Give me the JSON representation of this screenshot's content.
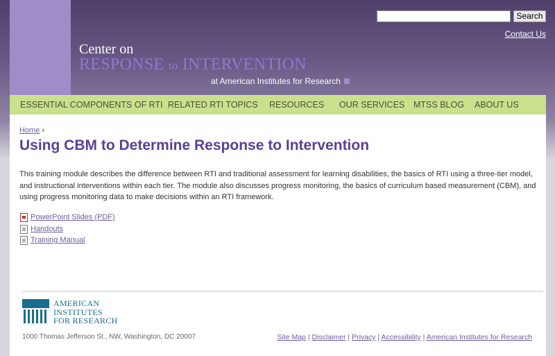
{
  "search": {
    "placeholder": "",
    "button_label": "Search"
  },
  "header": {
    "contact_label": "Contact Us",
    "logo": {
      "line1": "Center on",
      "line2_part1": "RESPONSE",
      "line2_part2": "to",
      "line2_part3": "INTERVENTION",
      "line3": "at American Institutes for Research"
    }
  },
  "nav": {
    "items": [
      "ESSENTIAL COMPONENTS OF RTI",
      "RELATED RTI TOPICS",
      "RESOURCES",
      "OUR SERVICES",
      "MTSS BLOG",
      "ABOUT US"
    ]
  },
  "breadcrumb": {
    "home": "Home",
    "separator": "›"
  },
  "page": {
    "title": "Using CBM to Determine Response to Intervention",
    "intro": "This training module describes the difference between RTI and traditional assessment for learning disabilities, the basics of RTI using a three-tier model, and instructional interventions within each tier. The module also discusses progress monitoring, the basics of curriculum based measurement (CBM), and using progress monitoring data to make decisions within an RTI framework."
  },
  "resources": [
    {
      "label": "PowerPoint Slides (PDF)",
      "icon": "pdf-file-icon"
    },
    {
      "label": "Handouts",
      "icon": "document-icon"
    },
    {
      "label": "Training Manual",
      "icon": "document-icon"
    }
  ],
  "footer": {
    "air_logo": {
      "line1": "AMERICAN",
      "line2": "INSTITUTES",
      "line3": "FOR RESEARCH"
    },
    "address": "1000 Thomas Jefferson St., NW, Washington, DC 20007",
    "links": [
      "Site Map",
      "Disclaimer",
      "Privacy",
      "Accessibility",
      "American Institutes for Research"
    ],
    "link_separator": "|"
  },
  "colors": {
    "header_bg": "#4f3f6b",
    "pillar": "#9f8dc9",
    "nav_bg": "#c9e08c",
    "title": "#5a3f96",
    "link": "#6f5c9f",
    "air_teal": "#1a6d8f"
  }
}
